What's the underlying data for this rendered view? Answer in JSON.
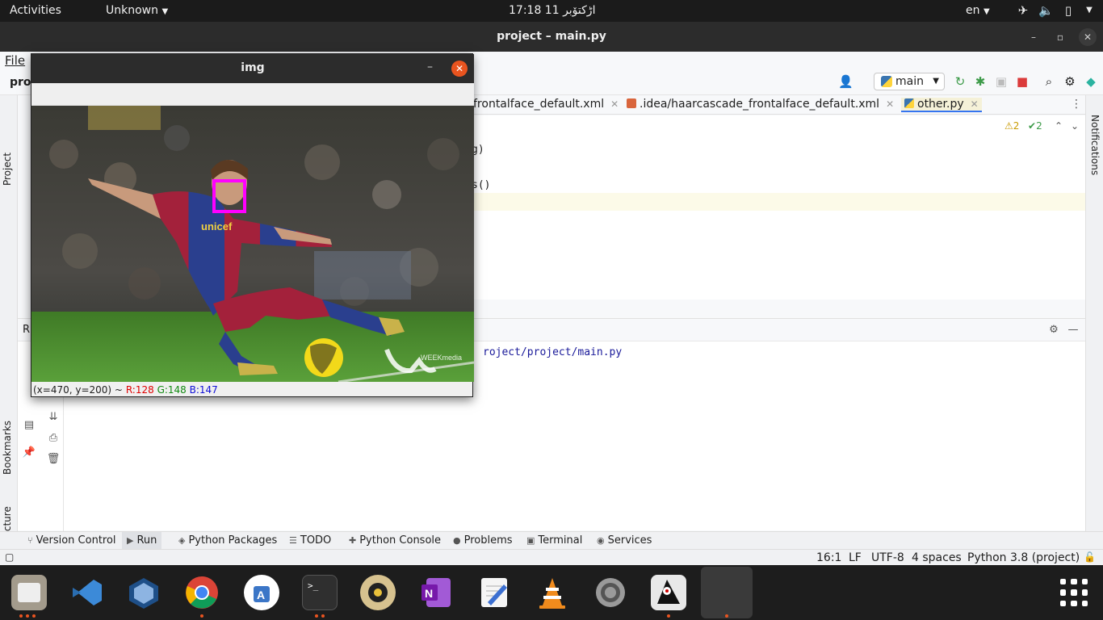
{
  "topbar": {
    "activities": "Activities",
    "app_menu": "Unknown",
    "clock": "17:18  11 اڑکتۆبر",
    "lang": "en"
  },
  "ide": {
    "window_title": "project – main.py",
    "menu_file": "File",
    "project_name": "proj",
    "run_config": "main",
    "tabs": [
      {
        "label": "frontalface_default.xml",
        "active": false
      },
      {
        "label": ".idea/haarcascade_frontalface_default.xml",
        "active": false
      },
      {
        "label": "other.py",
        "active": true
      }
    ],
    "code_fragments": [
      "g)",
      "s()"
    ],
    "inspect_warnings": "2",
    "inspect_ok": "2",
    "left_strip": [
      "Project",
      "Bookmarks",
      "Structure"
    ],
    "right_strip": "Notifications",
    "run_label_fragment": "R",
    "console_line": "roject/project/main.py",
    "bottom_tabs": [
      {
        "label": "Version Control",
        "icon": "branch-icon"
      },
      {
        "label": "Run",
        "icon": "run-icon",
        "active": true
      },
      {
        "label": "Python Packages",
        "icon": "packages-icon"
      },
      {
        "label": "TODO",
        "icon": "todo-icon"
      },
      {
        "label": "Python Console",
        "icon": "console-icon"
      },
      {
        "label": "Problems",
        "icon": "problems-icon"
      },
      {
        "label": "Terminal",
        "icon": "terminal-icon"
      },
      {
        "label": "Services",
        "icon": "services-icon"
      }
    ],
    "status": {
      "position": "16:1",
      "line_sep": "LF",
      "encoding": "UTF-8",
      "indent": "4 spaces",
      "interpreter": "Python 3.8 (project)"
    }
  },
  "img_window": {
    "title": "img",
    "coords_prefix": "(x=470, y=200) ~",
    "r": "R:128",
    "g": "G:148",
    "b": "B:147",
    "sponsor": "unicef",
    "watermark": "WEEKmedia",
    "box_color": "#ff00ff"
  },
  "dock": {
    "apps": [
      "files-icon",
      "vscode-icon",
      "virtualbox-icon",
      "chrome-icon",
      "store-icon",
      "terminal-icon",
      "rhythmbox-icon",
      "onenote-icon",
      "text-editor-icon",
      "vlc-icon",
      "settings-icon",
      "java-icon",
      "app-placeholder-icon"
    ]
  }
}
